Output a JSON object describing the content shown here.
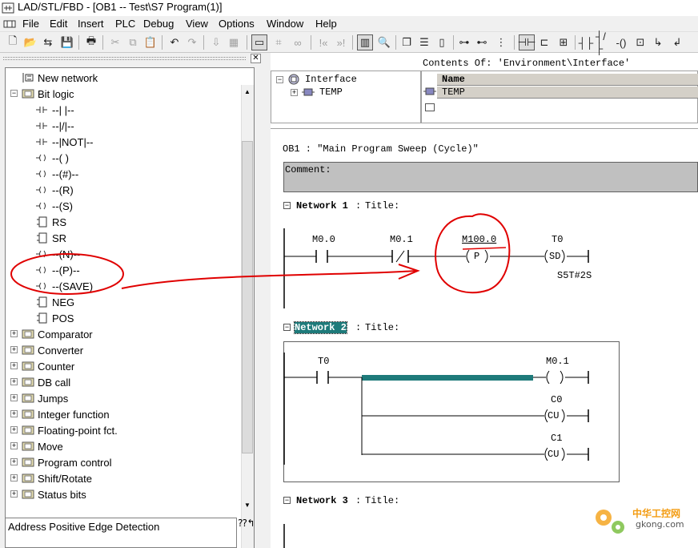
{
  "window": {
    "title": "LAD/STL/FBD  - [OB1 -- Test\\S7 Program(1)]"
  },
  "menu": [
    "File",
    "Edit",
    "Insert",
    "PLC",
    "Debug",
    "View",
    "Options",
    "Window",
    "Help"
  ],
  "catalog": {
    "items": [
      {
        "label": "New network",
        "icon": "new-network-icon",
        "expander": ""
      },
      {
        "label": "Bit logic",
        "icon": "bit-logic-icon",
        "expander": "-"
      },
      {
        "label": "--|  |--",
        "icon": "contact-icon",
        "expander": ""
      },
      {
        "label": "--|/|--",
        "icon": "contact-icon",
        "expander": ""
      },
      {
        "label": "--|NOT|--",
        "icon": "contact-icon",
        "expander": ""
      },
      {
        "label": "--( )",
        "icon": "coil-icon",
        "expander": ""
      },
      {
        "label": "--(#)--",
        "icon": "coil-icon",
        "expander": ""
      },
      {
        "label": "--(R)",
        "icon": "coil-icon",
        "expander": ""
      },
      {
        "label": "--(S)",
        "icon": "coil-icon",
        "expander": ""
      },
      {
        "label": "RS",
        "icon": "block-icon",
        "expander": ""
      },
      {
        "label": "SR",
        "icon": "block-icon",
        "expander": ""
      },
      {
        "label": "--(N)--",
        "icon": "coil-icon",
        "expander": ""
      },
      {
        "label": "--(P)--",
        "icon": "coil-icon",
        "expander": ""
      },
      {
        "label": "--(SAVE)",
        "icon": "coil-icon",
        "expander": ""
      },
      {
        "label": "NEG",
        "icon": "block-icon",
        "expander": ""
      },
      {
        "label": "POS",
        "icon": "block-icon",
        "expander": ""
      },
      {
        "label": "Comparator",
        "icon": "comparator-icon",
        "expander": "+"
      },
      {
        "label": "Converter",
        "icon": "converter-icon",
        "expander": "+"
      },
      {
        "label": "Counter",
        "icon": "counter-icon",
        "expander": "+"
      },
      {
        "label": "DB call",
        "icon": "db-call-icon",
        "expander": "+"
      },
      {
        "label": "Jumps",
        "icon": "jumps-icon",
        "expander": "+"
      },
      {
        "label": "Integer function",
        "icon": "integer-function-icon",
        "expander": "+"
      },
      {
        "label": "Floating-point fct.",
        "icon": "floating-point-icon",
        "expander": "+"
      },
      {
        "label": "Move",
        "icon": "move-icon",
        "expander": "+"
      },
      {
        "label": "Program control",
        "icon": "program-control-icon",
        "expander": "+"
      },
      {
        "label": "Shift/Rotate",
        "icon": "shift-rotate-icon",
        "expander": "+"
      },
      {
        "label": "Status bits",
        "icon": "status-bits-icon",
        "expander": "+"
      }
    ],
    "status_text": "Address Positive Edge Detection"
  },
  "interface": {
    "tree": [
      {
        "label": "Interface",
        "expander": "-"
      },
      {
        "label": "TEMP",
        "expander": "+"
      }
    ],
    "contents_label": "Contents Of: 'Environment\\Interface'",
    "column_header": "Name",
    "rows": [
      "TEMP"
    ]
  },
  "editor": {
    "block_title": "OB1 :  \"Main Program Sweep (Cycle)\"",
    "comment_label": "Comment:",
    "networks": [
      {
        "label": "Network 1",
        "title": "Title:"
      },
      {
        "label": "Network 2",
        "title": "Title:"
      },
      {
        "label": "Network 3",
        "title": "Title:"
      }
    ],
    "net1": {
      "contact1": "M0.0",
      "contact2": "M0.1",
      "edge_addr": "M100.0",
      "edge_symbol": "P",
      "timer": "T0",
      "timer_symbol": "SD",
      "timer_value": "S5T#2S"
    },
    "net2": {
      "contact": "T0",
      "coil1_addr": "M0.1",
      "coil1_symbol": "",
      "coil2_addr": "C0",
      "coil2_symbol": "CU",
      "coil3_addr": "C1",
      "coil3_symbol": "CU"
    }
  },
  "watermark": {
    "text": "中华工控网",
    "url_text": "gkong.com"
  },
  "colors": {
    "annotation": "#e00000",
    "highlight": "#1e7a7a",
    "comment_bg": "#c0c0c0"
  }
}
